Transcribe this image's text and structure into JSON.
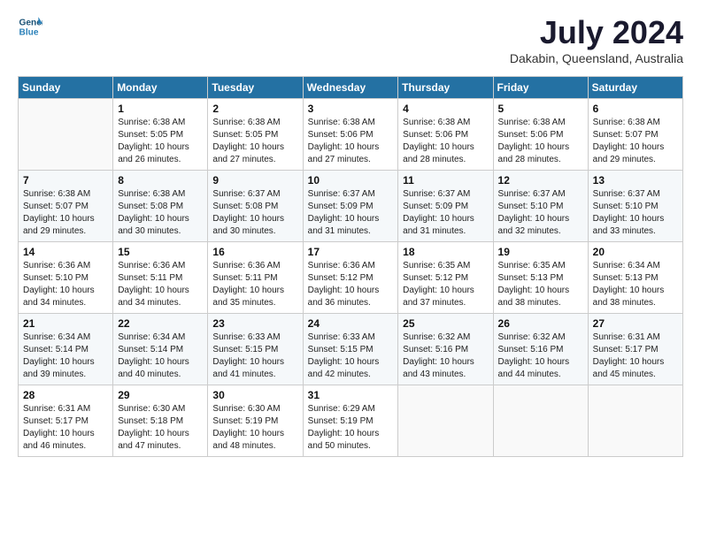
{
  "logo": {
    "line1": "General",
    "line2": "Blue"
  },
  "title": "July 2024",
  "location": "Dakabin, Queensland, Australia",
  "days_of_week": [
    "Sunday",
    "Monday",
    "Tuesday",
    "Wednesday",
    "Thursday",
    "Friday",
    "Saturday"
  ],
  "weeks": [
    [
      {
        "day": "",
        "sunrise": "",
        "sunset": "",
        "daylight": ""
      },
      {
        "day": "1",
        "sunrise": "Sunrise: 6:38 AM",
        "sunset": "Sunset: 5:05 PM",
        "daylight": "Daylight: 10 hours and 26 minutes."
      },
      {
        "day": "2",
        "sunrise": "Sunrise: 6:38 AM",
        "sunset": "Sunset: 5:05 PM",
        "daylight": "Daylight: 10 hours and 27 minutes."
      },
      {
        "day": "3",
        "sunrise": "Sunrise: 6:38 AM",
        "sunset": "Sunset: 5:06 PM",
        "daylight": "Daylight: 10 hours and 27 minutes."
      },
      {
        "day": "4",
        "sunrise": "Sunrise: 6:38 AM",
        "sunset": "Sunset: 5:06 PM",
        "daylight": "Daylight: 10 hours and 28 minutes."
      },
      {
        "day": "5",
        "sunrise": "Sunrise: 6:38 AM",
        "sunset": "Sunset: 5:06 PM",
        "daylight": "Daylight: 10 hours and 28 minutes."
      },
      {
        "day": "6",
        "sunrise": "Sunrise: 6:38 AM",
        "sunset": "Sunset: 5:07 PM",
        "daylight": "Daylight: 10 hours and 29 minutes."
      }
    ],
    [
      {
        "day": "7",
        "sunrise": "Sunrise: 6:38 AM",
        "sunset": "Sunset: 5:07 PM",
        "daylight": "Daylight: 10 hours and 29 minutes."
      },
      {
        "day": "8",
        "sunrise": "Sunrise: 6:38 AM",
        "sunset": "Sunset: 5:08 PM",
        "daylight": "Daylight: 10 hours and 30 minutes."
      },
      {
        "day": "9",
        "sunrise": "Sunrise: 6:37 AM",
        "sunset": "Sunset: 5:08 PM",
        "daylight": "Daylight: 10 hours and 30 minutes."
      },
      {
        "day": "10",
        "sunrise": "Sunrise: 6:37 AM",
        "sunset": "Sunset: 5:09 PM",
        "daylight": "Daylight: 10 hours and 31 minutes."
      },
      {
        "day": "11",
        "sunrise": "Sunrise: 6:37 AM",
        "sunset": "Sunset: 5:09 PM",
        "daylight": "Daylight: 10 hours and 31 minutes."
      },
      {
        "day": "12",
        "sunrise": "Sunrise: 6:37 AM",
        "sunset": "Sunset: 5:10 PM",
        "daylight": "Daylight: 10 hours and 32 minutes."
      },
      {
        "day": "13",
        "sunrise": "Sunrise: 6:37 AM",
        "sunset": "Sunset: 5:10 PM",
        "daylight": "Daylight: 10 hours and 33 minutes."
      }
    ],
    [
      {
        "day": "14",
        "sunrise": "Sunrise: 6:36 AM",
        "sunset": "Sunset: 5:10 PM",
        "daylight": "Daylight: 10 hours and 34 minutes."
      },
      {
        "day": "15",
        "sunrise": "Sunrise: 6:36 AM",
        "sunset": "Sunset: 5:11 PM",
        "daylight": "Daylight: 10 hours and 34 minutes."
      },
      {
        "day": "16",
        "sunrise": "Sunrise: 6:36 AM",
        "sunset": "Sunset: 5:11 PM",
        "daylight": "Daylight: 10 hours and 35 minutes."
      },
      {
        "day": "17",
        "sunrise": "Sunrise: 6:36 AM",
        "sunset": "Sunset: 5:12 PM",
        "daylight": "Daylight: 10 hours and 36 minutes."
      },
      {
        "day": "18",
        "sunrise": "Sunrise: 6:35 AM",
        "sunset": "Sunset: 5:12 PM",
        "daylight": "Daylight: 10 hours and 37 minutes."
      },
      {
        "day": "19",
        "sunrise": "Sunrise: 6:35 AM",
        "sunset": "Sunset: 5:13 PM",
        "daylight": "Daylight: 10 hours and 38 minutes."
      },
      {
        "day": "20",
        "sunrise": "Sunrise: 6:34 AM",
        "sunset": "Sunset: 5:13 PM",
        "daylight": "Daylight: 10 hours and 38 minutes."
      }
    ],
    [
      {
        "day": "21",
        "sunrise": "Sunrise: 6:34 AM",
        "sunset": "Sunset: 5:14 PM",
        "daylight": "Daylight: 10 hours and 39 minutes."
      },
      {
        "day": "22",
        "sunrise": "Sunrise: 6:34 AM",
        "sunset": "Sunset: 5:14 PM",
        "daylight": "Daylight: 10 hours and 40 minutes."
      },
      {
        "day": "23",
        "sunrise": "Sunrise: 6:33 AM",
        "sunset": "Sunset: 5:15 PM",
        "daylight": "Daylight: 10 hours and 41 minutes."
      },
      {
        "day": "24",
        "sunrise": "Sunrise: 6:33 AM",
        "sunset": "Sunset: 5:15 PM",
        "daylight": "Daylight: 10 hours and 42 minutes."
      },
      {
        "day": "25",
        "sunrise": "Sunrise: 6:32 AM",
        "sunset": "Sunset: 5:16 PM",
        "daylight": "Daylight: 10 hours and 43 minutes."
      },
      {
        "day": "26",
        "sunrise": "Sunrise: 6:32 AM",
        "sunset": "Sunset: 5:16 PM",
        "daylight": "Daylight: 10 hours and 44 minutes."
      },
      {
        "day": "27",
        "sunrise": "Sunrise: 6:31 AM",
        "sunset": "Sunset: 5:17 PM",
        "daylight": "Daylight: 10 hours and 45 minutes."
      }
    ],
    [
      {
        "day": "28",
        "sunrise": "Sunrise: 6:31 AM",
        "sunset": "Sunset: 5:17 PM",
        "daylight": "Daylight: 10 hours and 46 minutes."
      },
      {
        "day": "29",
        "sunrise": "Sunrise: 6:30 AM",
        "sunset": "Sunset: 5:18 PM",
        "daylight": "Daylight: 10 hours and 47 minutes."
      },
      {
        "day": "30",
        "sunrise": "Sunrise: 6:30 AM",
        "sunset": "Sunset: 5:19 PM",
        "daylight": "Daylight: 10 hours and 48 minutes."
      },
      {
        "day": "31",
        "sunrise": "Sunrise: 6:29 AM",
        "sunset": "Sunset: 5:19 PM",
        "daylight": "Daylight: 10 hours and 50 minutes."
      },
      {
        "day": "",
        "sunrise": "",
        "sunset": "",
        "daylight": ""
      },
      {
        "day": "",
        "sunrise": "",
        "sunset": "",
        "daylight": ""
      },
      {
        "day": "",
        "sunrise": "",
        "sunset": "",
        "daylight": ""
      }
    ]
  ]
}
